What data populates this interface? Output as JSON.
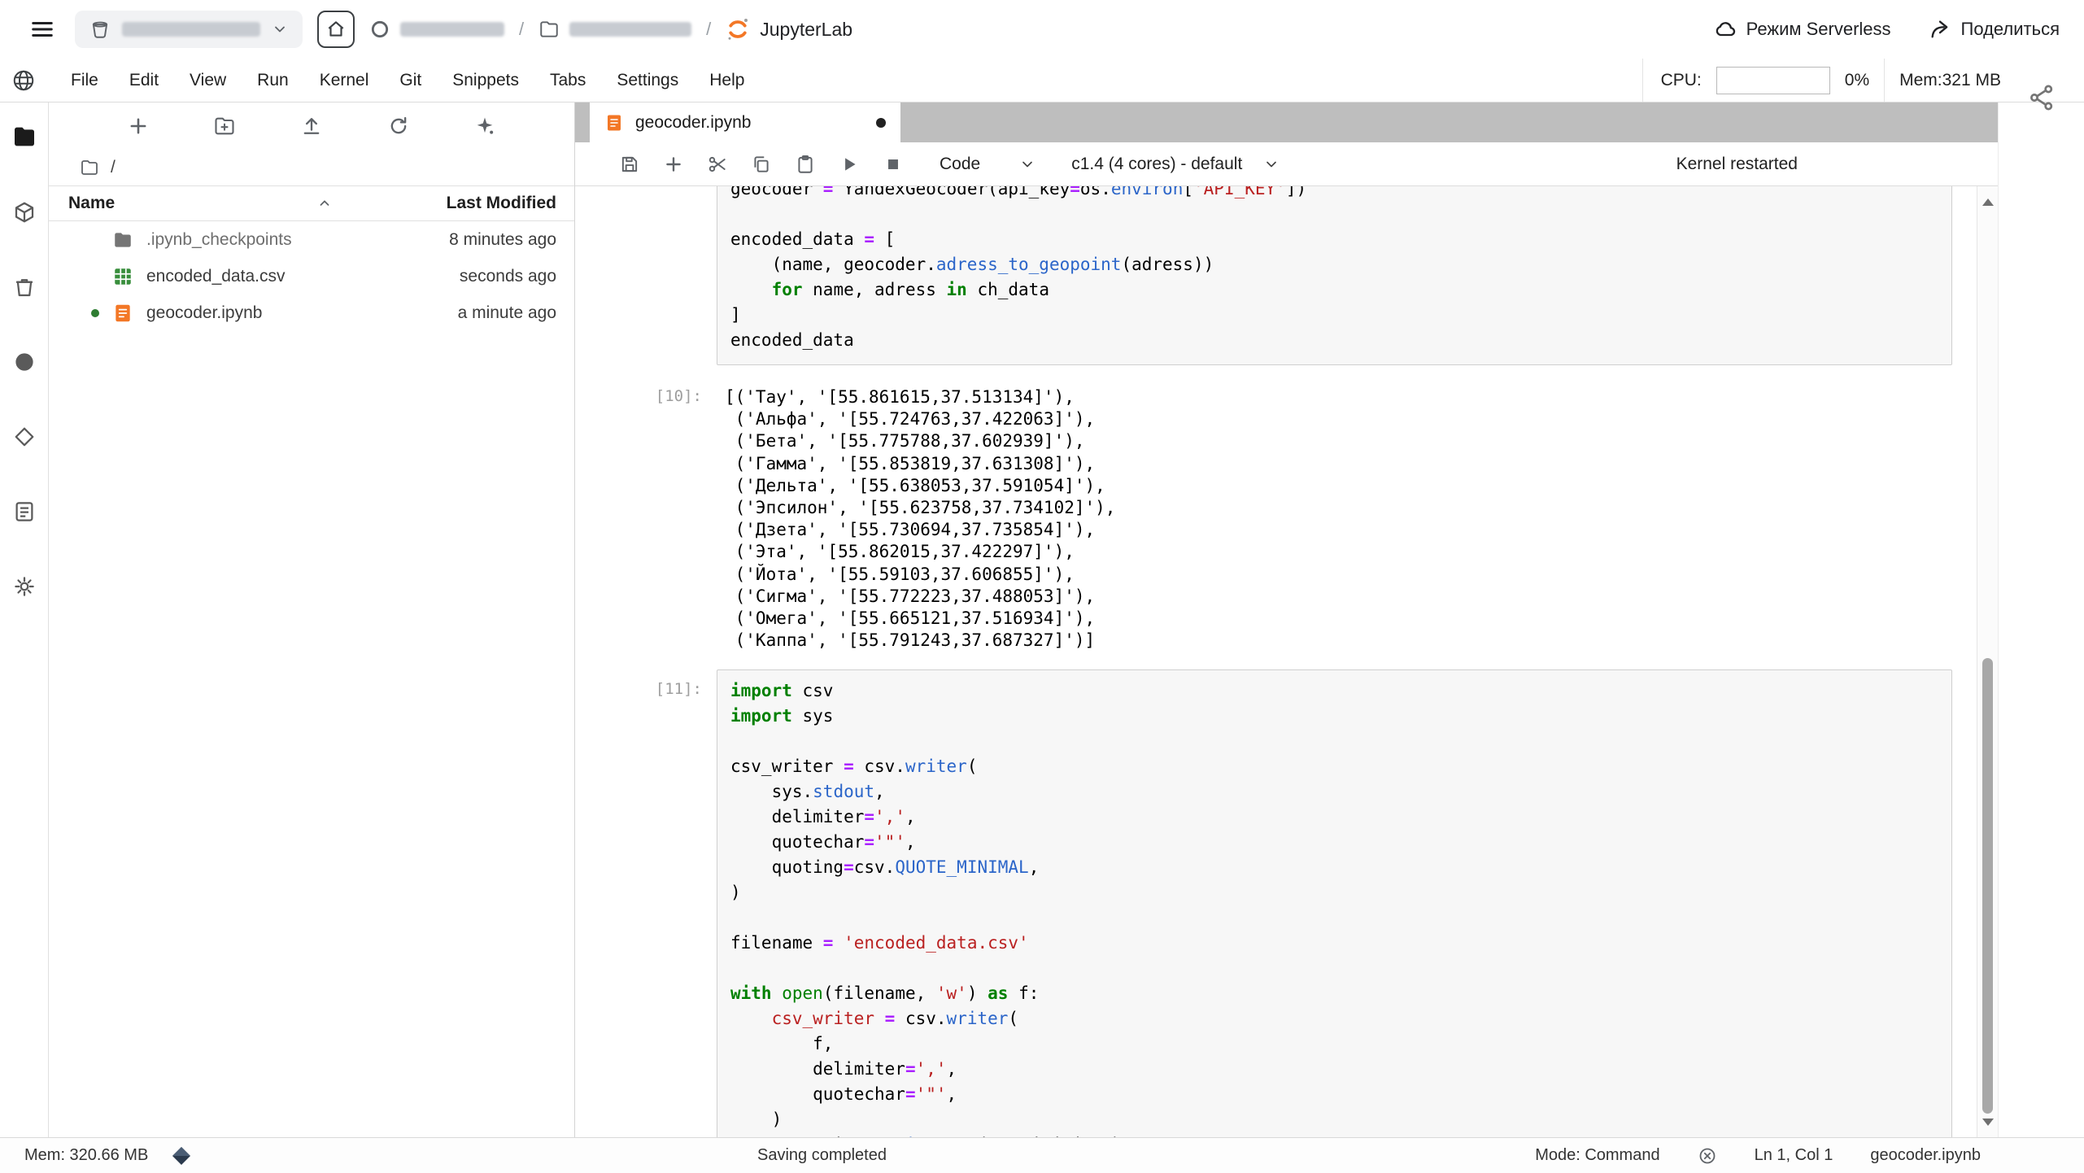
{
  "colors": {
    "accent-orange": "#F37726",
    "csv-green": "#388E3C",
    "kw-green": "#008000",
    "str-red": "#BA2121",
    "op-purple": "#AA22FF",
    "prop-blue": "#2B65C9",
    "prompt-gray": "#9E9E9E",
    "tabbar-gray": "#BEBEBE",
    "running-green": "#2E7D32"
  },
  "icons": {
    "hamburger": "menu",
    "bucket": "project bucket",
    "home": "home",
    "folder": "folder",
    "jupyter-logo": "orange planet",
    "cloud": "serverless cloud",
    "share-arrow": "share",
    "gear": "settings",
    "share-nodes": "share graph"
  },
  "topbar": {
    "jupyterlab": "JupyterLab",
    "separator": "/",
    "serverless": "Режим Serverless",
    "share": "Поделиться"
  },
  "menubar": {
    "items": [
      "File",
      "Edit",
      "View",
      "Run",
      "Kernel",
      "Git",
      "Snippets",
      "Tabs",
      "Settings",
      "Help"
    ],
    "cpu_label": "CPU:",
    "cpu_value": "0%",
    "mem_value": "Mem:321 MB"
  },
  "filebrowser": {
    "path": "/",
    "columns": {
      "name": "Name",
      "modified": "Last Modified"
    },
    "files": [
      {
        "name": ".ipynb_checkpoints",
        "modified": "8 minutes ago",
        "icon": "folder-icon",
        "kernel_running": false
      },
      {
        "name": "encoded_data.csv",
        "modified": "seconds ago",
        "icon": "csv-icon",
        "kernel_running": false
      },
      {
        "name": "geocoder.ipynb",
        "modified": "a minute ago",
        "icon": "notebook-icon",
        "kernel_running": true
      }
    ]
  },
  "tabbar": {
    "active_tab": "geocoder.ipynb",
    "dirty": true
  },
  "nb_toolbar": {
    "cell_type": "Code",
    "kernel": "c1.4 (4 cores) - default",
    "status_message": "Kernel restarted"
  },
  "notebook": {
    "cells": [
      {
        "kind": "code",
        "prompt": "",
        "lines": [
          [
            {
              "t": "geocoder ",
              "c": "v"
            },
            {
              "t": "=",
              "c": "op"
            },
            {
              "t": " YandexGeocoder(api_key",
              "c": "v"
            },
            {
              "t": "=",
              "c": "op"
            },
            {
              "t": "os.",
              "c": "v"
            },
            {
              "t": "environ",
              "c": "prop"
            },
            {
              "t": "[",
              "c": "v"
            },
            {
              "t": "'API_KEY'",
              "c": "str"
            },
            {
              "t": "])",
              "c": "v"
            }
          ],
          [],
          [
            {
              "t": "encoded_data ",
              "c": "v"
            },
            {
              "t": "=",
              "c": "op"
            },
            {
              "t": " [",
              "c": "v"
            }
          ],
          [
            {
              "t": "    (name, geocoder.",
              "c": "v"
            },
            {
              "t": "adress_to_geopoint",
              "c": "prop"
            },
            {
              "t": "(adress))",
              "c": "v"
            }
          ],
          [
            {
              "t": "    ",
              "c": "v"
            },
            {
              "t": "for",
              "c": "kw"
            },
            {
              "t": " name, adress ",
              "c": "v"
            },
            {
              "t": "in",
              "c": "kw"
            },
            {
              "t": " ch_data",
              "c": "v"
            }
          ],
          [
            {
              "t": "]",
              "c": "v"
            }
          ],
          [
            {
              "t": "encoded_data",
              "c": "v"
            }
          ]
        ]
      },
      {
        "kind": "output",
        "prompt": "[10]:",
        "lines": [
          "[('Тау', '[55.861615,37.513134]'),",
          " ('Альфа', '[55.724763,37.422063]'),",
          " ('Бета', '[55.775788,37.602939]'),",
          " ('Гамма', '[55.853819,37.631308]'),",
          " ('Дельта', '[55.638053,37.591054]'),",
          " ('Эпсилон', '[55.623758,37.734102]'),",
          " ('Дзета', '[55.730694,37.735854]'),",
          " ('Эта', '[55.862015,37.422297]'),",
          " ('Йота', '[55.59103,37.606855]'),",
          " ('Сигма', '[55.772223,37.488053]'),",
          " ('Омега', '[55.665121,37.516934]'),",
          " ('Каппа', '[55.791243,37.687327]')]"
        ]
      },
      {
        "kind": "code",
        "prompt": "[11]:",
        "lines": [
          [
            {
              "t": "import",
              "c": "kw"
            },
            {
              "t": " csv",
              "c": "v"
            }
          ],
          [
            {
              "t": "import",
              "c": "kw"
            },
            {
              "t": " sys",
              "c": "v"
            }
          ],
          [],
          [
            {
              "t": "csv_writer ",
              "c": "v"
            },
            {
              "t": "=",
              "c": "op"
            },
            {
              "t": " csv.",
              "c": "v"
            },
            {
              "t": "writer",
              "c": "prop"
            },
            {
              "t": "(",
              "c": "v"
            }
          ],
          [
            {
              "t": "    sys.",
              "c": "v"
            },
            {
              "t": "stdout",
              "c": "prop"
            },
            {
              "t": ",",
              "c": "v"
            }
          ],
          [
            {
              "t": "    delimiter",
              "c": "v"
            },
            {
              "t": "=",
              "c": "op"
            },
            {
              "t": "','",
              "c": "str"
            },
            {
              "t": ",",
              "c": "v"
            }
          ],
          [
            {
              "t": "    quotechar",
              "c": "v"
            },
            {
              "t": "=",
              "c": "op"
            },
            {
              "t": "'\"'",
              "c": "str"
            },
            {
              "t": ",",
              "c": "v"
            }
          ],
          [
            {
              "t": "    quoting",
              "c": "v"
            },
            {
              "t": "=",
              "c": "op"
            },
            {
              "t": "csv.",
              "c": "v"
            },
            {
              "t": "QUOTE_MINIMAL",
              "c": "prop"
            },
            {
              "t": ",",
              "c": "v"
            }
          ],
          [
            {
              "t": ")",
              "c": "v"
            }
          ],
          [],
          [
            {
              "t": "filename ",
              "c": "v"
            },
            {
              "t": "=",
              "c": "op"
            },
            {
              "t": " ",
              "c": "v"
            },
            {
              "t": "'encoded_data.csv'",
              "c": "str"
            }
          ],
          [],
          [
            {
              "t": "with",
              "c": "kw"
            },
            {
              "t": " ",
              "c": "v"
            },
            {
              "t": "open",
              "c": "kw2"
            },
            {
              "t": "(filename, ",
              "c": "v"
            },
            {
              "t": "'w'",
              "c": "str"
            },
            {
              "t": ") ",
              "c": "v"
            },
            {
              "t": "as",
              "c": "kw"
            },
            {
              "t": " f:",
              "c": "v"
            }
          ],
          [
            {
              "t": "    ",
              "c": "v"
            },
            {
              "t": "csv_writer",
              "c": "str"
            },
            {
              "t": " ",
              "c": "v"
            },
            {
              "t": "=",
              "c": "op"
            },
            {
              "t": " csv.",
              "c": "v"
            },
            {
              "t": "writer",
              "c": "prop"
            },
            {
              "t": "(",
              "c": "v"
            }
          ],
          [
            {
              "t": "        f,",
              "c": "v"
            }
          ],
          [
            {
              "t": "        delimiter",
              "c": "v"
            },
            {
              "t": "=",
              "c": "op"
            },
            {
              "t": "','",
              "c": "str"
            },
            {
              "t": ",",
              "c": "v"
            }
          ],
          [
            {
              "t": "        quotechar",
              "c": "v"
            },
            {
              "t": "=",
              "c": "op"
            },
            {
              "t": "'\"'",
              "c": "str"
            },
            {
              "t": ",",
              "c": "v"
            }
          ],
          [
            {
              "t": "    )",
              "c": "v"
            }
          ],
          [
            {
              "t": "    csv_writer.",
              "c": "v"
            },
            {
              "t": "writerows",
              "c": "prop"
            },
            {
              "t": "(encoded_data)",
              "c": "v"
            }
          ]
        ]
      }
    ]
  },
  "statusbar": {
    "mem": "Mem: 320.66 MB",
    "message": "Saving completed",
    "mode": "Mode: Command",
    "cursor": "Ln 1, Col 1",
    "file": "geocoder.ipynb"
  }
}
